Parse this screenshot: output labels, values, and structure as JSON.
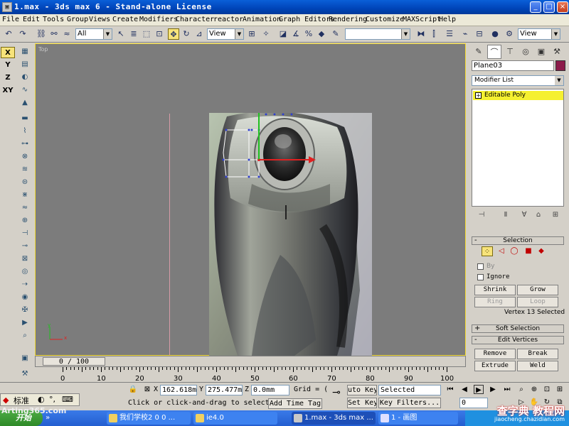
{
  "window": {
    "title": "1.max - 3ds max 6 - Stand-alone License",
    "controls": [
      "_",
      "□",
      "×"
    ]
  },
  "menu": [
    "File",
    "Edit",
    "Tools",
    "Group",
    "Views",
    "Create",
    "Modifiers",
    "Character",
    "reactor",
    "Animation",
    "Graph Editors",
    "Rendering",
    "Customize",
    "MAXScript",
    "Help"
  ],
  "toolbar": {
    "selection_filter": "All",
    "reference_coord": "View",
    "named_selection": "",
    "view_dropdown": "View"
  },
  "axis_constraints": [
    "X",
    "Y",
    "Z",
    "XY"
  ],
  "viewport": {
    "label": "Top",
    "tripod_x": "x",
    "tripod_y": "y"
  },
  "command_panel": {
    "object_name": "Plane03",
    "object_color": "#8c1b4a",
    "modifier_list": "Modifier List",
    "stack_item": "Editable Poly",
    "selection_rollout": "Selection",
    "by_label": "By",
    "ignore_label": "Ignore",
    "shrink": "Shrink",
    "grow": "Grow",
    "ring": "Ring",
    "loop": "Loop",
    "vertex_status": "Vertex 13 Selected",
    "soft_selection_rollout": "Soft Selection",
    "edit_vertices_rollout": "Edit Vertices",
    "remove": "Remove",
    "break": "Break",
    "extrude": "Extrude",
    "weld": "Weld"
  },
  "timeline": {
    "slider_text": "0 / 100",
    "ticks": [
      "0",
      "10",
      "20",
      "30",
      "40",
      "50",
      "60",
      "70",
      "80",
      "90",
      "100"
    ]
  },
  "status": {
    "x_label": "X",
    "x_value": "162.618m",
    "y_label": "Y",
    "y_value": "275.477m",
    "z_label": "Z",
    "z_value": "0.0mm",
    "grid": "Grid = (",
    "prompt": "Click or click-and-drag to select ol",
    "add_time_tag": "Add Time Tag",
    "auto_key": "uto Key",
    "key_mode": "Selected",
    "set_key": "Set Key",
    "key_filters": "Key Filters...",
    "frame": "0"
  },
  "ime": {
    "label": "标准"
  },
  "taskbar": {
    "start": "开始",
    "tasks": [
      "我们学校2 0 0 ...",
      "ie4.0",
      "1.max - 3ds max ...",
      "1 - 画图"
    ]
  },
  "watermarks": {
    "left": "Arting365.com",
    "right": "查字典 教程网",
    "right_sub": "jiaocheng.chazidian.com"
  }
}
